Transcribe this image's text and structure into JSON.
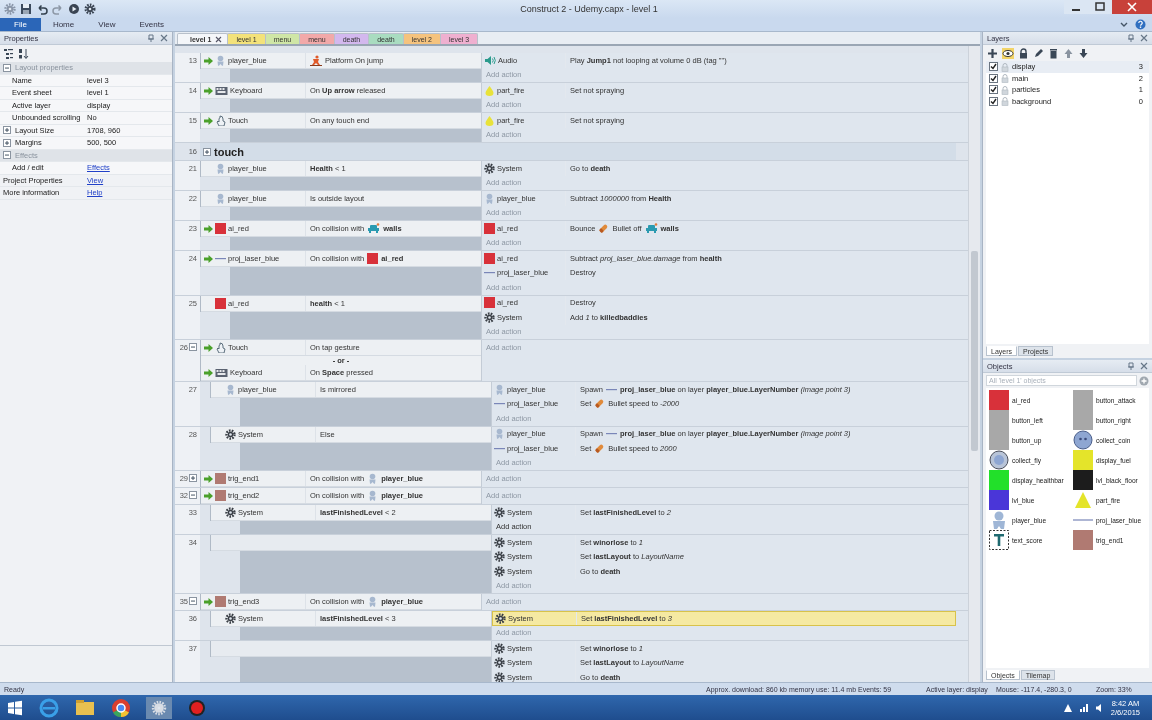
{
  "window": {
    "title": "Construct 2 - Udemy.capx - level 1"
  },
  "ribbon_tabs": [
    {
      "label": "File",
      "selected": true
    },
    {
      "label": "Home",
      "selected": false
    },
    {
      "label": "View",
      "selected": false
    },
    {
      "label": "Events",
      "selected": false
    }
  ],
  "properties": {
    "title": "Properties",
    "rows": [
      {
        "kind": "section",
        "label": "Layout properties",
        "expanded": true
      },
      {
        "kind": "prop",
        "label": "Name",
        "value": "level 3"
      },
      {
        "kind": "prop",
        "label": "Event sheet",
        "value": "level 1"
      },
      {
        "kind": "prop",
        "label": "Active layer",
        "value": "display"
      },
      {
        "kind": "prop",
        "label": "Unbounded scrolling",
        "value": "No"
      },
      {
        "kind": "prop",
        "label": "Layout Size",
        "value": "1708, 960",
        "expanded": false
      },
      {
        "kind": "prop",
        "label": "Margins",
        "value": "500, 500",
        "expanded": false
      },
      {
        "kind": "section",
        "label": "Effects",
        "expanded": true
      },
      {
        "kind": "link",
        "label": "Add / edit",
        "value": "Effects"
      },
      {
        "kind": "toplink",
        "label": "Project Properties",
        "value": "View"
      },
      {
        "kind": "toplink",
        "label": "More information",
        "value": "Help"
      }
    ]
  },
  "doc_tabs": [
    {
      "label": "level 1",
      "selected": true,
      "color": "#f4f6f9"
    },
    {
      "label": "level 1",
      "selected": false,
      "color": "#f3e27a"
    },
    {
      "label": "menu",
      "selected": false,
      "color": "#cfe6a6"
    },
    {
      "label": "menu",
      "selected": false,
      "color": "#f2a9a9"
    },
    {
      "label": "death",
      "selected": false,
      "color": "#d3b8ee"
    },
    {
      "label": "death",
      "selected": false,
      "color": "#a9dcc0"
    },
    {
      "label": "level 2",
      "selected": false,
      "color": "#f5c37e"
    },
    {
      "label": "level 3",
      "selected": false,
      "color": "#efb0d0"
    }
  ],
  "events": [
    {
      "kind": "event",
      "number": "13",
      "conditions": [
        {
          "object": "player_blue",
          "kind": "player",
          "trigger": true,
          "parts": [
            {
              "kind": "platform"
            },
            {
              "kind": "text",
              "text": "Platform On jump"
            }
          ]
        }
      ],
      "actions": [
        {
          "object": "Audio",
          "kind": "speaker",
          "text": "Play **Jump1** not looping at volume 0 dB (tag \"\")",
          "selected": false
        }
      ],
      "add_action": "Add action",
      "add_hover": false
    },
    {
      "kind": "event",
      "number": "14",
      "conditions": [
        {
          "object": "Keyboard",
          "kind": "keyboard",
          "trigger": true,
          "text": "On **Up arrow** released"
        }
      ],
      "actions": [
        {
          "object": "part_fire",
          "kind": "particles",
          "text": "Set not spraying",
          "selected": false
        }
      ],
      "add_action": "Add action",
      "add_hover": false
    },
    {
      "kind": "event",
      "number": "15",
      "conditions": [
        {
          "object": "Touch",
          "kind": "touch",
          "trigger": true,
          "text": "On any touch end"
        }
      ],
      "actions": [
        {
          "object": "part_fire",
          "kind": "particles",
          "text": "Set not spraying",
          "selected": false
        }
      ],
      "add_action": "Add action",
      "add_hover": false
    },
    {
      "kind": "group",
      "number": "16",
      "title": "touch",
      "expanded": false
    },
    {
      "kind": "event",
      "number": "21",
      "conditions": [
        {
          "object": "player_blue",
          "kind": "player",
          "trigger": false,
          "text": "**Health** < 1"
        }
      ],
      "actions": [
        {
          "object": "System",
          "kind": "system",
          "text": "Go to **death**",
          "selected": false
        }
      ],
      "add_action": "Add action",
      "add_hover": false
    },
    {
      "kind": "event",
      "number": "22",
      "conditions": [
        {
          "object": "player_blue",
          "kind": "player",
          "trigger": false,
          "text": "Is outside layout"
        }
      ],
      "actions": [
        {
          "object": "player_blue",
          "kind": "player",
          "text": "Subtract *1000000* from **Health**",
          "selected": false
        }
      ],
      "add_action": "Add action",
      "add_hover": false
    },
    {
      "kind": "event",
      "number": "23",
      "conditions": [
        {
          "object": "ai_red",
          "kind": "sprite",
          "color": "#d8313a",
          "trigger": true,
          "parts": [
            {
              "kind": "text",
              "text": "On collision with"
            },
            {
              "kind": "walls"
            },
            {
              "kind": "text",
              "text": "**walls**"
            }
          ]
        }
      ],
      "actions": [
        {
          "object": "ai_red",
          "kind": "sprite",
          "color": "#d8313a",
          "selected": false,
          "parts": [
            {
              "kind": "text",
              "text": "Bounce"
            },
            {
              "kind": "bullet"
            },
            {
              "kind": "text",
              "text": "Bullet off"
            },
            {
              "kind": "walls"
            },
            {
              "kind": "text",
              "text": "**walls**"
            }
          ]
        }
      ],
      "add_action": "Add action",
      "add_hover": false
    },
    {
      "kind": "event",
      "number": "24",
      "conditions": [
        {
          "object": "proj_laser_blue",
          "kind": "line",
          "trigger": true,
          "parts": [
            {
              "kind": "text",
              "text": "On collision with"
            },
            {
              "kind": "sprite",
              "color": "#d8313a"
            },
            {
              "kind": "text",
              "text": "**ai_red**"
            }
          ]
        }
      ],
      "actions": [
        {
          "object": "ai_red",
          "kind": "sprite",
          "color": "#d8313a",
          "text": "Subtract *proj_laser_blue.damage* from **health**",
          "selected": false
        },
        {
          "object": "proj_laser_blue",
          "kind": "line",
          "text": "Destroy",
          "selected": false
        }
      ],
      "add_action": "Add action",
      "add_hover": false
    },
    {
      "kind": "event",
      "number": "25",
      "conditions": [
        {
          "object": "ai_red",
          "kind": "sprite",
          "color": "#d8313a",
          "trigger": false,
          "text": "**health** < 1"
        }
      ],
      "actions": [
        {
          "object": "ai_red",
          "kind": "sprite",
          "color": "#d8313a",
          "text": "Destroy",
          "selected": false
        },
        {
          "object": "System",
          "kind": "system",
          "text": "Add *1* to **killedbaddies**",
          "selected": false
        }
      ],
      "add_action": "Add action",
      "add_hover": false
    },
    {
      "kind": "event",
      "number": "26",
      "expanded": true,
      "conditions": [
        {
          "object": "Touch",
          "kind": "touch",
          "trigger": true,
          "text": "On tap gesture"
        },
        {
          "kind": "or",
          "text": "- or -"
        },
        {
          "object": "Keyboard",
          "kind": "keyboard",
          "trigger": true,
          "text": "On **Space** pressed"
        }
      ],
      "add_action": "Add action",
      "add_hover": false,
      "children": [
        {
          "kind": "event",
          "number": "27",
          "conditions": [
            {
              "object": "player_blue",
              "kind": "player",
              "trigger": false,
              "text": "Is mirrored"
            }
          ],
          "actions": [
            {
              "object": "player_blue",
              "kind": "player",
              "selected": false,
              "parts": [
                {
                  "kind": "text",
                  "text": "Spawn"
                },
                {
                  "kind": "line"
                },
                {
                  "kind": "text",
                  "text": "**proj_laser_blue** on layer **player_blue.LayerNumber** *(image point 3)*"
                }
              ]
            },
            {
              "object": "proj_laser_blue",
              "kind": "line",
              "selected": false,
              "parts": [
                {
                  "kind": "text",
                  "text": "Set"
                },
                {
                  "kind": "bullet"
                },
                {
                  "kind": "text",
                  "text": "Bullet speed to *-2000*"
                }
              ]
            }
          ],
          "add_action": "Add action",
          "add_hover": false
        },
        {
          "kind": "event",
          "number": "28",
          "conditions": [
            {
              "object": "System",
              "kind": "system",
              "trigger": false,
              "text": "Else"
            }
          ],
          "actions": [
            {
              "object": "player_blue",
              "kind": "player",
              "selected": false,
              "parts": [
                {
                  "kind": "text",
                  "text": "Spawn"
                },
                {
                  "kind": "line"
                },
                {
                  "kind": "text",
                  "text": "**proj_laser_blue** on layer **player_blue.LayerNumber** *(image point 3)*"
                }
              ]
            },
            {
              "object": "proj_laser_blue",
              "kind": "line",
              "selected": false,
              "parts": [
                {
                  "kind": "text",
                  "text": "Set"
                },
                {
                  "kind": "bullet"
                },
                {
                  "kind": "text",
                  "text": "Bullet speed to *2000*"
                }
              ]
            }
          ],
          "add_action": "Add action",
          "add_hover": false
        }
      ]
    },
    {
      "kind": "event",
      "number": "29",
      "expanded": false,
      "conditions": [
        {
          "object": "trig_end1",
          "kind": "sprite",
          "color": "#b07a72",
          "trigger": true,
          "parts": [
            {
              "kind": "text",
              "text": "On collision with"
            },
            {
              "kind": "player"
            },
            {
              "kind": "text",
              "text": "**player_blue**"
            }
          ]
        }
      ],
      "add_action": "Add action",
      "add_hover": false
    },
    {
      "kind": "event",
      "number": "32",
      "expanded": true,
      "conditions": [
        {
          "object": "trig_end2",
          "kind": "sprite",
          "color": "#b07a72",
          "trigger": true,
          "parts": [
            {
              "kind": "text",
              "text": "On collision with"
            },
            {
              "kind": "player"
            },
            {
              "kind": "text",
              "text": "**player_blue**"
            }
          ]
        }
      ],
      "add_action": "Add action",
      "add_hover": false,
      "children": [
        {
          "kind": "event",
          "number": "33",
          "conditions": [
            {
              "object": "System",
              "kind": "system",
              "trigger": false,
              "text": "**lastFinishedLevel** < 2"
            }
          ],
          "actions": [
            {
              "object": "System",
              "kind": "system",
              "text": "Set **lastFinishedLevel** to *2*",
              "selected": false
            }
          ],
          "add_action": "Add action",
          "add_hover": true
        },
        {
          "kind": "event",
          "number": "34",
          "actions": [
            {
              "object": "System",
              "kind": "system",
              "text": "Set **winorlose** to *1*",
              "selected": false
            },
            {
              "object": "System",
              "kind": "system",
              "text": "Set **lastLayout** to *LayoutName*",
              "selected": false
            },
            {
              "object": "System",
              "kind": "system",
              "text": "Go to **death**",
              "selected": false
            }
          ],
          "add_action": "Add action",
          "add_hover": false
        }
      ]
    },
    {
      "kind": "event",
      "number": "35",
      "expanded": true,
      "conditions": [
        {
          "object": "trig_end3",
          "kind": "sprite",
          "color": "#b07a72",
          "trigger": true,
          "parts": [
            {
              "kind": "text",
              "text": "On collision with"
            },
            {
              "kind": "player"
            },
            {
              "kind": "text",
              "text": "**player_blue**"
            }
          ]
        }
      ],
      "add_action": "Add action",
      "add_hover": false,
      "children": [
        {
          "kind": "event",
          "number": "36",
          "conditions": [
            {
              "object": "System",
              "kind": "system",
              "trigger": false,
              "text": "**lastFinishedLevel** < 3"
            }
          ],
          "actions": [
            {
              "object": "System",
              "kind": "system",
              "text": "Set **lastFinishedLevel** to *3*",
              "selected": true
            }
          ],
          "add_action": "Add action",
          "add_hover": false
        },
        {
          "kind": "event",
          "number": "37",
          "actions": [
            {
              "object": "System",
              "kind": "system",
              "text": "Set **winorlose** to *1*",
              "selected": false
            },
            {
              "object": "System",
              "kind": "system",
              "text": "Set **lastLayout** to *LayoutName*",
              "selected": false
            },
            {
              "object": "System",
              "kind": "system",
              "text": "Go to **death**",
              "selected": false
            }
          ]
        }
      ]
    }
  ],
  "layers": {
    "title": "Layers",
    "items": [
      {
        "name": "display",
        "number": "3",
        "checked": true,
        "selected": true
      },
      {
        "name": "main",
        "number": "2",
        "checked": true,
        "selected": false
      },
      {
        "name": "particles",
        "number": "1",
        "checked": true,
        "selected": false
      },
      {
        "name": "background",
        "number": "0",
        "checked": true,
        "selected": false
      }
    ],
    "tabs": [
      {
        "label": "Layers",
        "selected": true
      },
      {
        "label": "Projects",
        "selected": false
      }
    ]
  },
  "objects": {
    "title": "Objects",
    "placeholder": "All 'level 1' objects",
    "items": [
      {
        "name": "ai_red",
        "kind": "sprite",
        "color": "#d8313a"
      },
      {
        "name": "button_attack",
        "kind": "sprite",
        "color": "#a8a8a8"
      },
      {
        "name": "button_left",
        "kind": "sprite",
        "color": "#a8a8a8"
      },
      {
        "name": "button_right",
        "kind": "sprite",
        "color": "#a8a8a8"
      },
      {
        "name": "button_up",
        "kind": "sprite",
        "color": "#a8a8a8"
      },
      {
        "name": "collect_coin",
        "kind": "coin"
      },
      {
        "name": "collect_fly",
        "kind": "orb"
      },
      {
        "name": "display_fuel",
        "kind": "sprite",
        "color": "#e4e42a"
      },
      {
        "name": "display_healthbar",
        "kind": "sprite",
        "color": "#22e02a"
      },
      {
        "name": "lvl_black_floor",
        "kind": "sprite",
        "color": "#1c1c1c"
      },
      {
        "name": "lvl_blue",
        "kind": "sprite",
        "color": "#4a36d8"
      },
      {
        "name": "part_fire",
        "kind": "particles"
      },
      {
        "name": "player_blue",
        "kind": "player"
      },
      {
        "name": "proj_laser_blue",
        "kind": "line"
      },
      {
        "name": "text_score",
        "kind": "text"
      },
      {
        "name": "trig_end1",
        "kind": "sprite",
        "color": "#b07a72"
      }
    ],
    "tabs": [
      {
        "label": "Objects",
        "selected": true
      },
      {
        "label": "Tilemap",
        "selected": false
      }
    ]
  },
  "status_bar": {
    "state": "Ready",
    "stats": "Approx. download: 860 kb  memory use: 11.4 mb  Events: 59",
    "active_layer": "Active layer: display",
    "mouse": "Mouse: -117.4, -280.3, 0",
    "zoom": "Zoom: 33%"
  },
  "taskbar": {
    "time": "8:42 AM",
    "date": "2/6/2015"
  }
}
